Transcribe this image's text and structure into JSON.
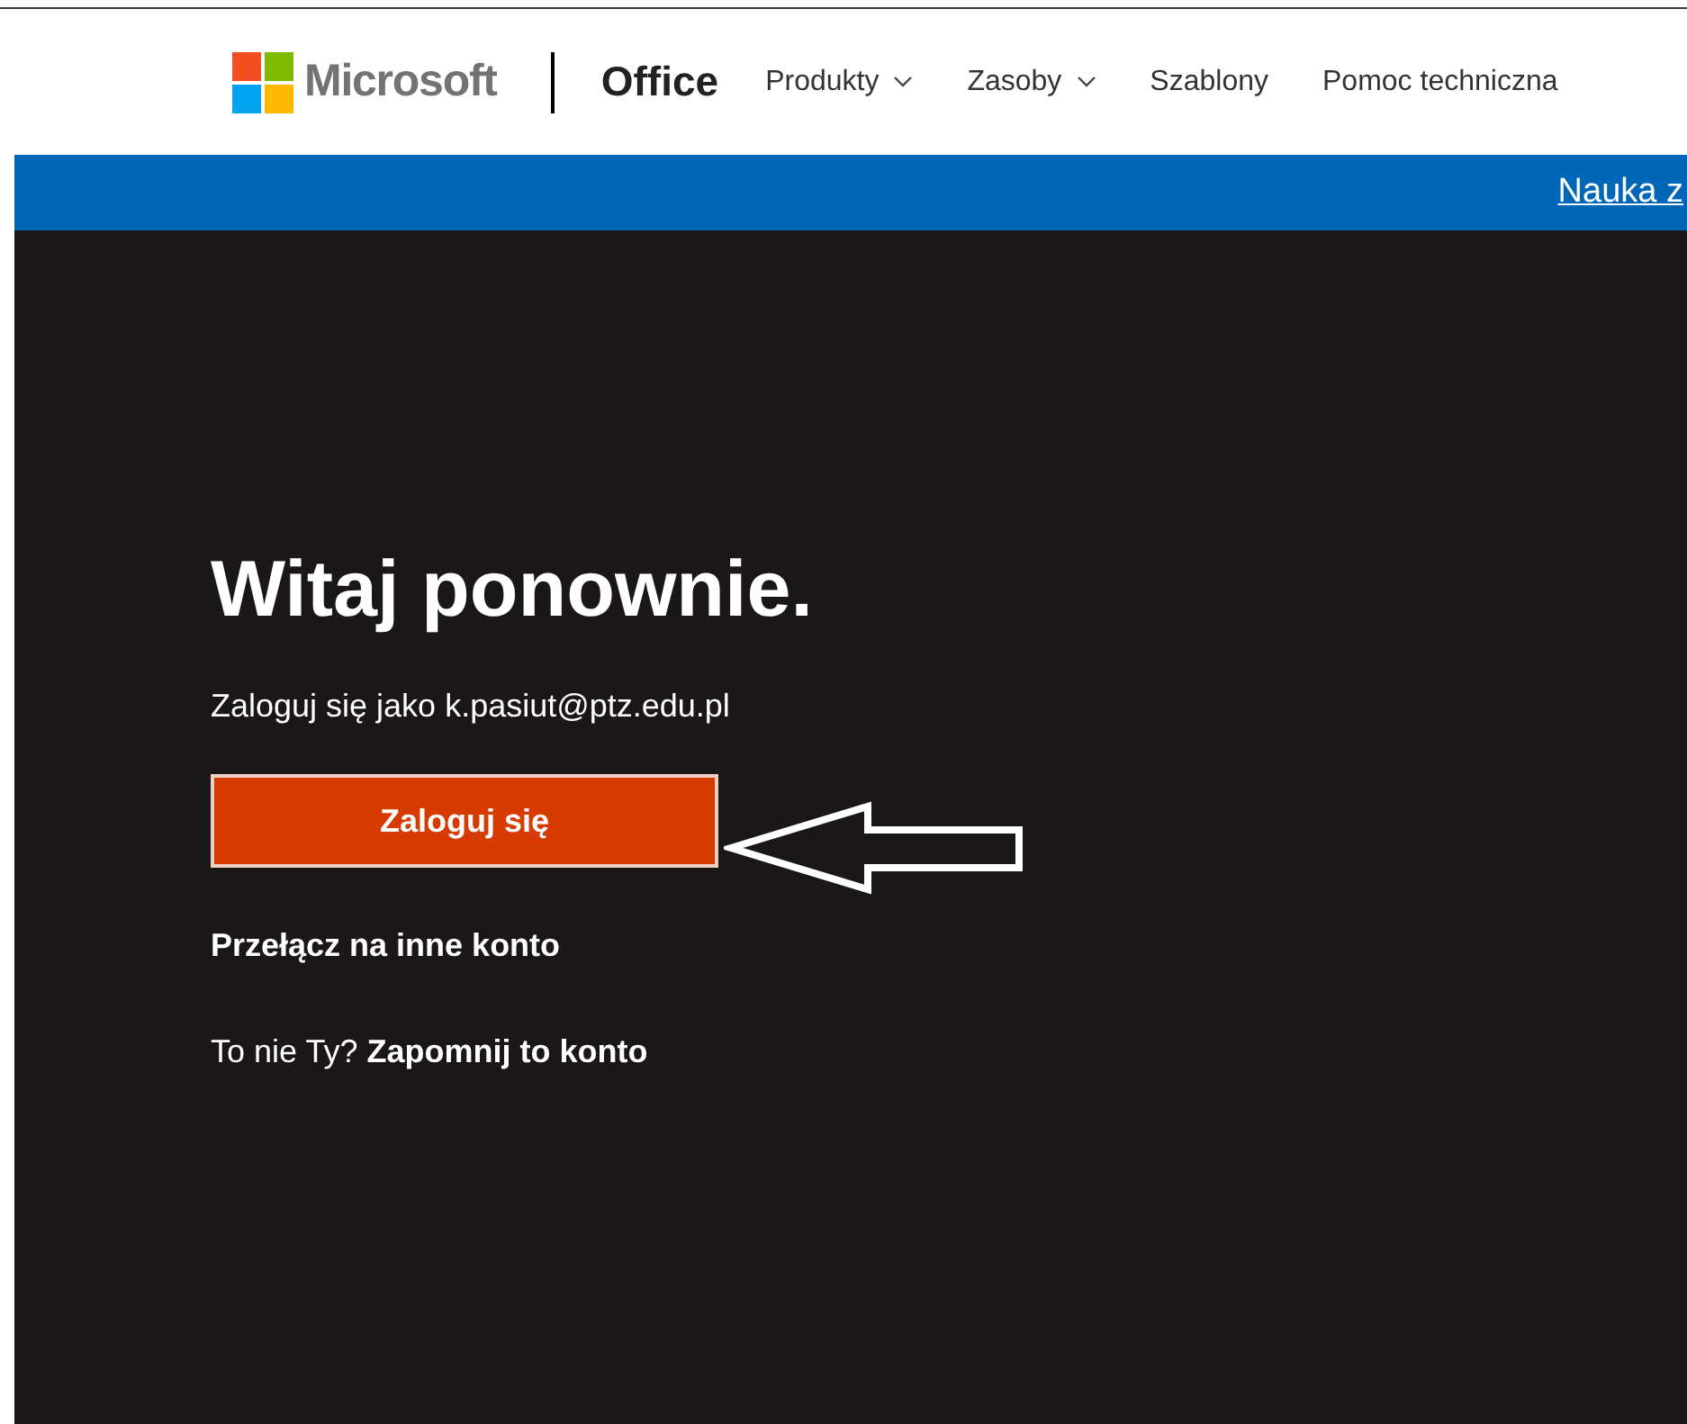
{
  "header": {
    "brand": "Microsoft",
    "product": "Office",
    "nav": [
      {
        "label": "Produkty",
        "kind": "dropdown"
      },
      {
        "label": "Zasoby",
        "kind": "dropdown"
      },
      {
        "label": "Szablony",
        "kind": "link"
      },
      {
        "label": "Pomoc techniczna",
        "kind": "link"
      }
    ]
  },
  "banner": {
    "link": "Nauka z"
  },
  "signin": {
    "title": "Witaj ponownie.",
    "account_text": "Zaloguj się jako k.pasiut@ptz.edu.pl",
    "button": "Zaloguj się",
    "switch_link": "Przełącz na inne konto",
    "not_you": "To nie Ty?",
    "forget_link": "Zapomnij to konto"
  }
}
